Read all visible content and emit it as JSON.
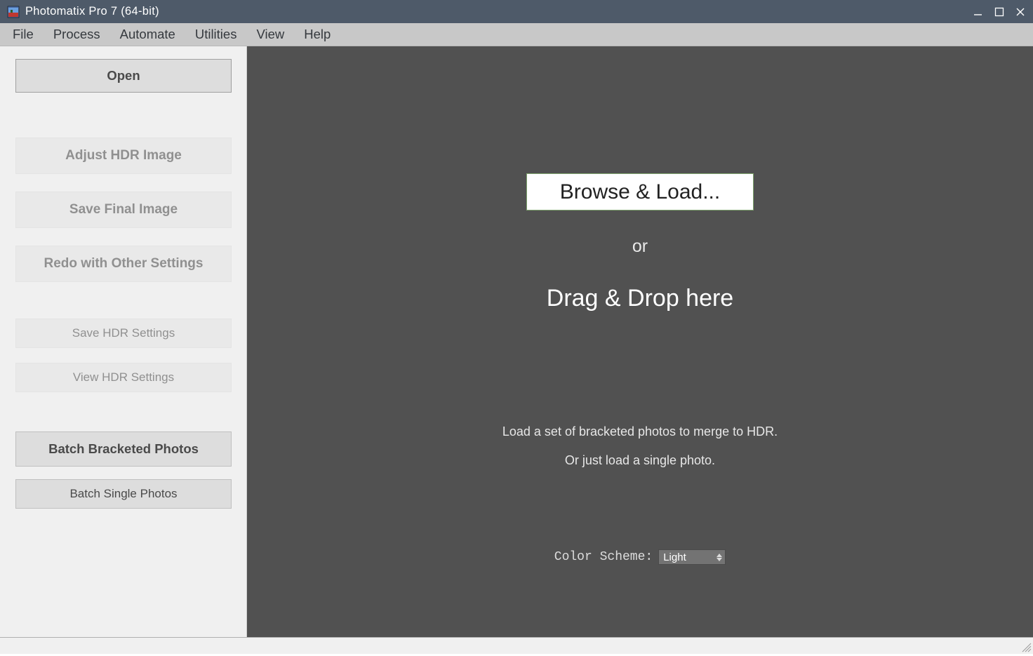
{
  "titlebar": {
    "title": "Photomatix Pro 7  (64-bit)"
  },
  "menu": {
    "items": [
      "File",
      "Process",
      "Automate",
      "Utilities",
      "View",
      "Help"
    ]
  },
  "sidebar": {
    "open": "Open",
    "adjust_hdr": "Adjust HDR Image",
    "save_final": "Save Final Image",
    "redo": "Redo with Other Settings",
    "save_settings": "Save HDR Settings",
    "view_settings": "View HDR Settings",
    "batch_bracketed": "Batch Bracketed Photos",
    "batch_single": "Batch Single Photos"
  },
  "main": {
    "browse": "Browse & Load...",
    "or": "or",
    "dragdrop": "Drag & Drop here",
    "info1": "Load a set of bracketed photos to merge to HDR.",
    "info2": "Or just load a single photo.",
    "color_scheme_label": "Color Scheme:",
    "color_scheme_value": "Light"
  }
}
